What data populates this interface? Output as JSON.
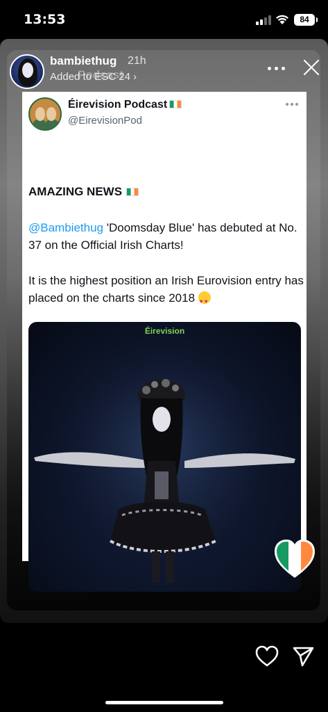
{
  "status_bar": {
    "time": "13:53",
    "battery": "84"
  },
  "story": {
    "username": "bambiethug",
    "time_ago": "21h",
    "subtitle": "Added to ESC 24 ›",
    "subtitle_overlay": "Podcast"
  },
  "tweet": {
    "display_name": "Éirevision Podcast",
    "handle": "@EirevisionPod",
    "headline": "AMAZING NEWS",
    "mention": "@Bambiethug",
    "body_1_rest": " 'Doomsday Blue' has debuted at No. 37 on the Official Irish Charts!",
    "body_2": "It is the highest position an Irish Eurovision entry has placed on the charts since 2018",
    "media_logo": "Éirevision"
  },
  "icons": {
    "close": "close-icon",
    "more": "more-icon",
    "like": "heart-icon",
    "share": "send-icon",
    "flag": "irish-flag-icon"
  },
  "colors": {
    "mention": "#1d9bf0",
    "irish_green": "#169b62",
    "irish_orange": "#ff883e"
  }
}
